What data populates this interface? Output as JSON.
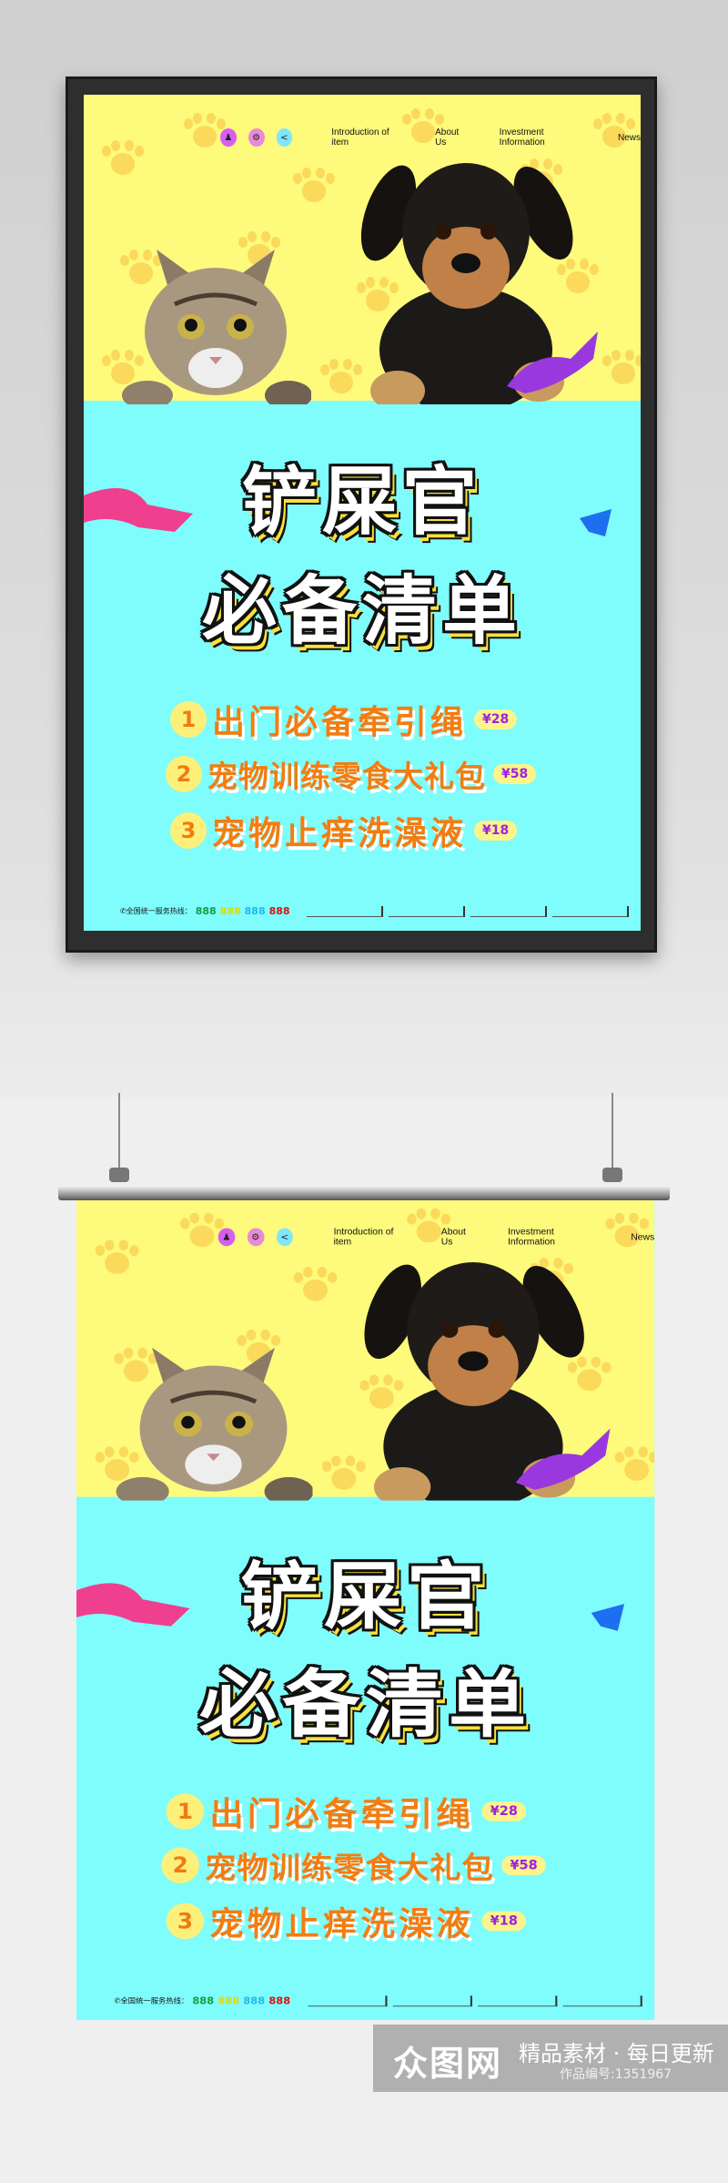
{
  "poster": {
    "nav": {
      "icons": [
        "user-icon",
        "gear-icon",
        "share-icon"
      ],
      "icon_colors": [
        "#d65ef2",
        "#e88ad8",
        "#7fe6fb"
      ],
      "links": [
        "Introduction of item",
        "About Us",
        "Investment Information",
        "News"
      ]
    },
    "title_line1": "铲屎官",
    "title_line2": "必备清单",
    "items": [
      {
        "num": "1",
        "text": "出门必备牵引绳",
        "price": "¥28"
      },
      {
        "num": "2",
        "text": "宠物训练零食大礼包",
        "price": "¥58"
      },
      {
        "num": "3",
        "text": "宠物止痒洗澡液",
        "price": "¥18"
      }
    ],
    "footer": {
      "hotline_label": "全国统一服务热线：",
      "numbers": [
        "888",
        "888",
        "888",
        "888"
      ],
      "number_colors": [
        "#10a040",
        "#f3e400",
        "#20b8f0",
        "#e01010"
      ]
    },
    "colors": {
      "top": "#fdfa7c",
      "bottom": "#7ffcfc",
      "title_text": "#ffffff",
      "item_text": "#f47c10",
      "price": "#a020e0"
    }
  },
  "watermark": {
    "logo": "众图网",
    "slogan": "精品素材 · 每日更新",
    "code": "作品编号:1351967"
  }
}
